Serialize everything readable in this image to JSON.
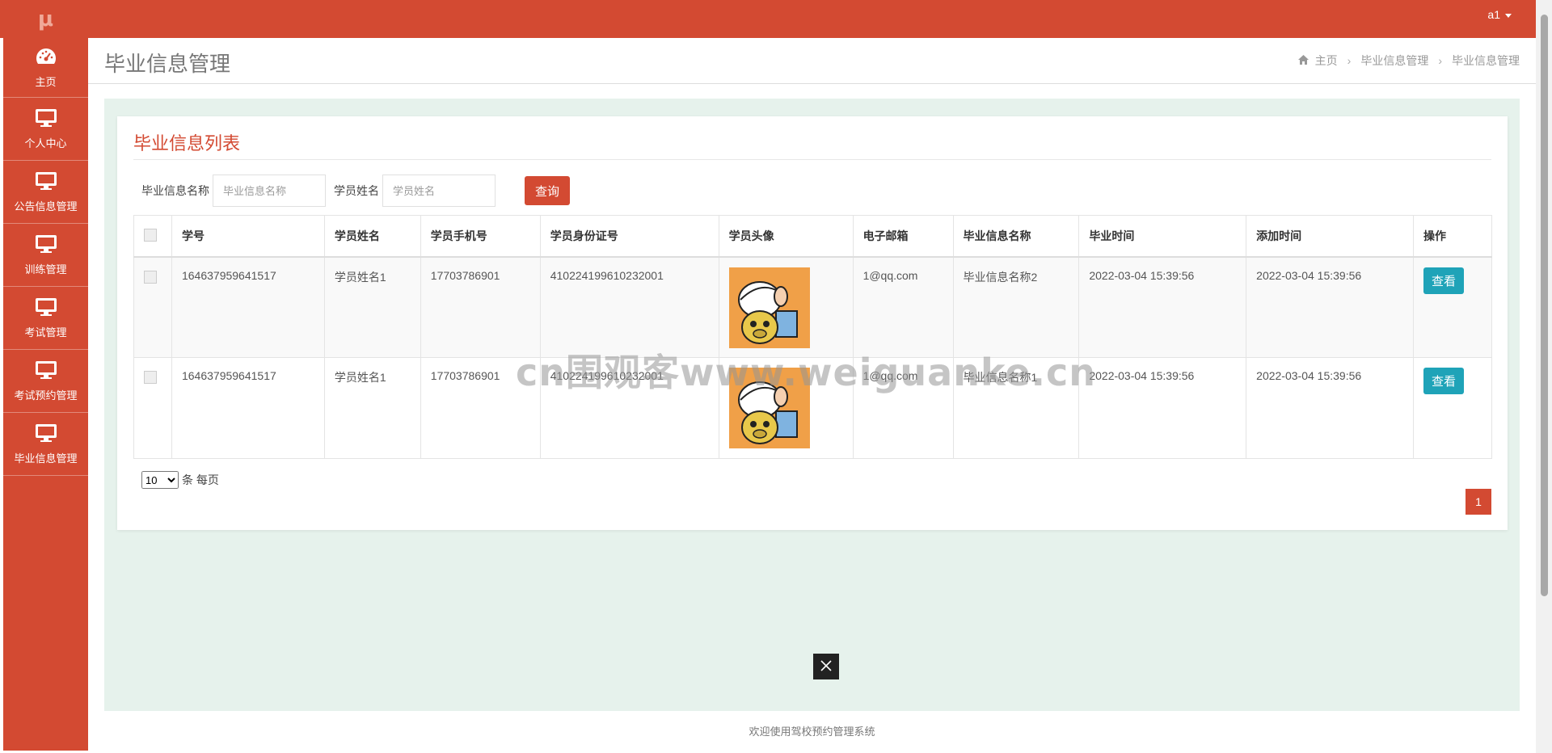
{
  "app": {
    "logo": "μ",
    "user": "a1"
  },
  "sidebar": {
    "items": [
      {
        "label": "主页",
        "icon": "dashboard-icon"
      },
      {
        "label": "个人中心",
        "icon": "monitor-icon"
      },
      {
        "label": "公告信息管理",
        "icon": "monitor-icon"
      },
      {
        "label": "训练管理",
        "icon": "monitor-icon"
      },
      {
        "label": "考试管理",
        "icon": "monitor-icon"
      },
      {
        "label": "考试预约管理",
        "icon": "monitor-icon"
      },
      {
        "label": "毕业信息管理",
        "icon": "monitor-icon"
      }
    ]
  },
  "header": {
    "title": "毕业信息管理",
    "breadcrumb": [
      "主页",
      "毕业信息管理",
      "毕业信息管理"
    ]
  },
  "panel": {
    "title": "毕业信息列表",
    "search": {
      "field1_label": "毕业信息名称",
      "field1_placeholder": "毕业信息名称",
      "field2_label": "学员姓名",
      "field2_placeholder": "学员姓名",
      "query_label": "查询"
    },
    "table": {
      "columns": [
        "学号",
        "学员姓名",
        "学员手机号",
        "学员身份证号",
        "学员头像",
        "电子邮箱",
        "毕业信息名称",
        "毕业时间",
        "添加时间",
        "操作"
      ],
      "rows": [
        {
          "id": "164637959641517",
          "name": "学员姓名1",
          "phone": "17703786901",
          "idcard": "410224199610232001",
          "email": "1@qq.com",
          "grad_name": "毕业信息名称2",
          "grad_time": "2022-03-04 15:39:56",
          "added_time": "2022-03-04 15:39:56",
          "action": "查看"
        },
        {
          "id": "164637959641517",
          "name": "学员姓名1",
          "phone": "17703786901",
          "idcard": "410224199610232001",
          "email": "1@qq.com",
          "grad_name": "毕业信息名称1",
          "grad_time": "2022-03-04 15:39:56",
          "added_time": "2022-03-04 15:39:56",
          "action": "查看"
        }
      ]
    },
    "page_size": "10",
    "page_size_suffix": "条 每页",
    "current_page": "1"
  },
  "watermark": "cn围观客www.weiguanke.cn",
  "footer": "欢迎使用驾校预约管理系统",
  "colors": {
    "brand": "#d34a32",
    "view_button": "#1fa3b8",
    "content_bg": "#e6f2ec"
  }
}
